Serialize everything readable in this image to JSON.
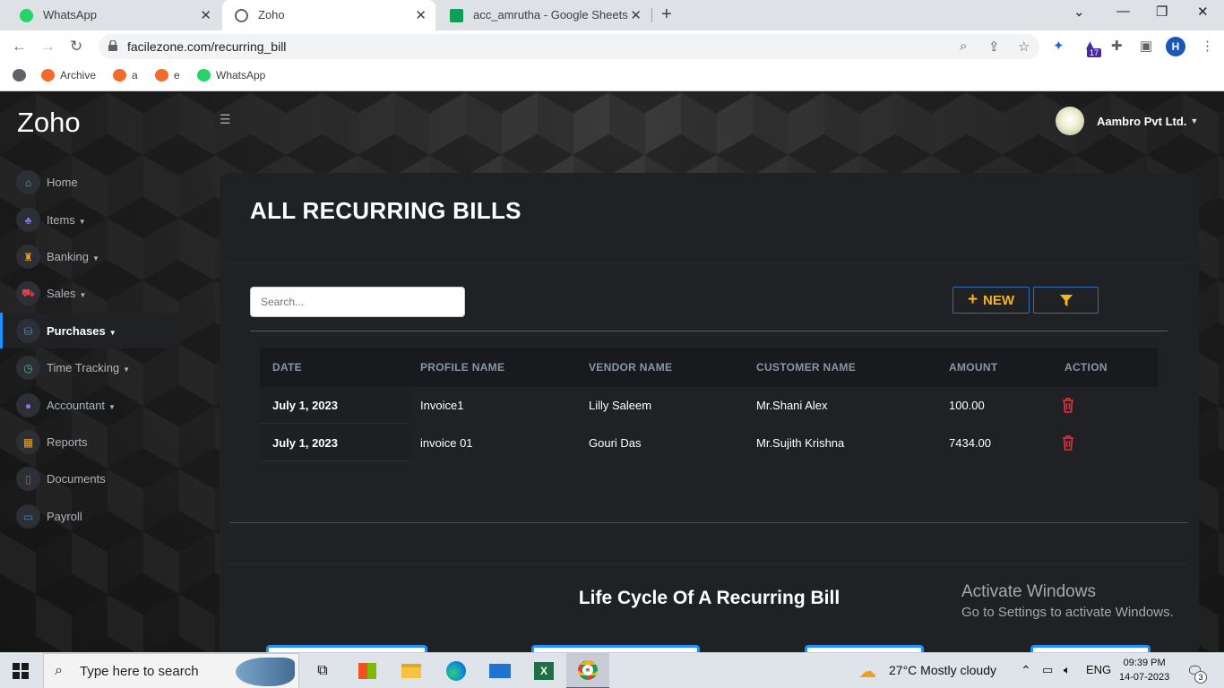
{
  "browser": {
    "tabs": [
      {
        "label": "WhatsApp",
        "icon": "whatsapp-icon",
        "color": "#25d366"
      },
      {
        "label": "Zoho",
        "icon": "globe-icon",
        "color": "#5f6368"
      },
      {
        "label": "acc_amrutha - Google Sheets",
        "icon": "sheets-icon",
        "color": "#0f9d58"
      }
    ],
    "url": "facilezone.com/recurring_bill",
    "profile_initial": "H",
    "extension_badge": "17",
    "bookmarks": [
      "Archive",
      "a",
      "e",
      "WhatsApp"
    ]
  },
  "app": {
    "logo": "Zoho",
    "account_name": "Aambro Pvt Ltd.",
    "sidebar": [
      {
        "label": "Home",
        "icon": "home-icon",
        "color": "#2ecc71",
        "caret": false
      },
      {
        "label": "Items",
        "icon": "sitemap-icon",
        "color": "#8e6cf0",
        "caret": true
      },
      {
        "label": "Banking",
        "icon": "bank-icon",
        "color": "#f0a020",
        "caret": true
      },
      {
        "label": "Sales",
        "icon": "cart-icon",
        "color": "#e0404a",
        "caret": true
      },
      {
        "label": "Purchases",
        "icon": "basket-icon",
        "color": "#1e90ff",
        "caret": true
      },
      {
        "label": "Time Tracking",
        "icon": "clock-icon",
        "color": "#2ecc71",
        "caret": true
      },
      {
        "label": "Accountant",
        "icon": "user-icon",
        "color": "#8e6cf0",
        "caret": true
      },
      {
        "label": "Reports",
        "icon": "calendar-icon",
        "color": "#f0a020",
        "caret": false
      },
      {
        "label": "Documents",
        "icon": "file-icon",
        "color": "#e0404a",
        "caret": false
      },
      {
        "label": "Payroll",
        "icon": "money-icon",
        "color": "#1e90ff",
        "caret": false
      }
    ],
    "page_title": "ALL RECURRING BILLS",
    "search_placeholder": "Search...",
    "new_label": "NEW",
    "table": {
      "headers": [
        "DATE",
        "PROFILE NAME",
        "VENDOR NAME",
        "CUSTOMER NAME",
        "AMOUNT",
        "ACTION"
      ],
      "rows": [
        {
          "date": "July 1, 2023",
          "profile": "Invoice1",
          "vendor": "Lilly Saleem",
          "customer": "Mr.Shani Alex",
          "amount": "100.00"
        },
        {
          "date": "July 1, 2023",
          "profile": "invoice 01",
          "vendor": "Gouri Das",
          "customer": "Mr.Sujith Krishna",
          "amount": "7434.00"
        }
      ]
    },
    "lifecycle_title": "Life Cycle Of A Recurring Bill",
    "watermark": {
      "line1": "Activate Windows",
      "line2": "Go to Settings to activate Windows."
    }
  },
  "taskbar": {
    "search_text": "Type here to search",
    "weather": "27°C  Mostly cloudy",
    "language": "ENG",
    "time": "09:39 PM",
    "date": "14-07-2023",
    "notifications": "3"
  }
}
